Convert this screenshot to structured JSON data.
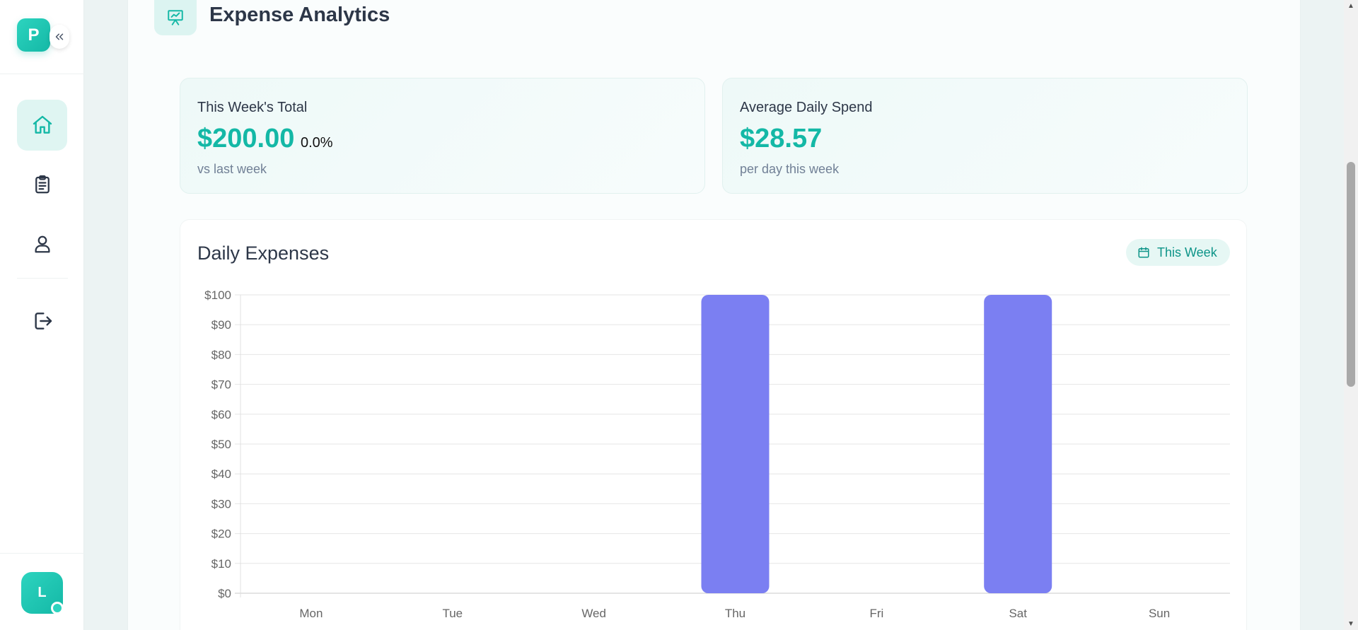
{
  "sidebar": {
    "logo_letter": "P",
    "nav_icons": [
      "home-icon",
      "clipboard-icon",
      "user-icon",
      "logout-icon"
    ],
    "active_item": "home",
    "user_initial": "L"
  },
  "header": {
    "title": "Expense Analytics",
    "icon": "presentation-chart-icon"
  },
  "stats": {
    "week_total": {
      "label": "This Week's Total",
      "value": "$200.00",
      "change": "0.0%",
      "sub": "vs last week"
    },
    "daily_avg": {
      "label": "Average Daily Spend",
      "value": "$28.57",
      "sub": "per day this week"
    }
  },
  "chart_section": {
    "title": "Daily Expenses",
    "period_label": "This Week"
  },
  "colors": {
    "accent": "#14b8a6",
    "bar": "#7b7ff2"
  },
  "chart_data": {
    "type": "bar",
    "categories": [
      "Mon",
      "Tue",
      "Wed",
      "Thu",
      "Fri",
      "Sat",
      "Sun"
    ],
    "values": [
      0,
      0,
      0,
      100,
      0,
      100,
      0
    ],
    "ylim": [
      0,
      100
    ],
    "yticks": [
      "$0",
      "$10",
      "$20",
      "$30",
      "$40",
      "$50",
      "$60",
      "$70",
      "$80",
      "$90",
      "$100"
    ],
    "grid": true
  }
}
